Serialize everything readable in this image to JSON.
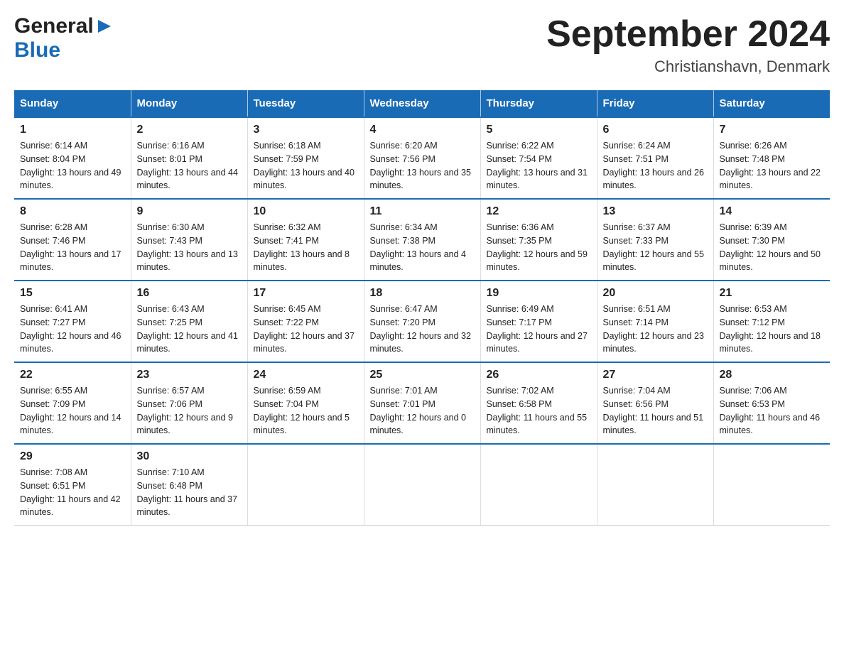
{
  "header": {
    "logo_general": "General",
    "logo_blue": "Blue",
    "month_title": "September 2024",
    "location": "Christianshavn, Denmark"
  },
  "calendar": {
    "days_of_week": [
      "Sunday",
      "Monday",
      "Tuesday",
      "Wednesday",
      "Thursday",
      "Friday",
      "Saturday"
    ],
    "weeks": [
      [
        {
          "day": "1",
          "sunrise": "6:14 AM",
          "sunset": "8:04 PM",
          "daylight": "13 hours and 49 minutes."
        },
        {
          "day": "2",
          "sunrise": "6:16 AM",
          "sunset": "8:01 PM",
          "daylight": "13 hours and 44 minutes."
        },
        {
          "day": "3",
          "sunrise": "6:18 AM",
          "sunset": "7:59 PM",
          "daylight": "13 hours and 40 minutes."
        },
        {
          "day": "4",
          "sunrise": "6:20 AM",
          "sunset": "7:56 PM",
          "daylight": "13 hours and 35 minutes."
        },
        {
          "day": "5",
          "sunrise": "6:22 AM",
          "sunset": "7:54 PM",
          "daylight": "13 hours and 31 minutes."
        },
        {
          "day": "6",
          "sunrise": "6:24 AM",
          "sunset": "7:51 PM",
          "daylight": "13 hours and 26 minutes."
        },
        {
          "day": "7",
          "sunrise": "6:26 AM",
          "sunset": "7:48 PM",
          "daylight": "13 hours and 22 minutes."
        }
      ],
      [
        {
          "day": "8",
          "sunrise": "6:28 AM",
          "sunset": "7:46 PM",
          "daylight": "13 hours and 17 minutes."
        },
        {
          "day": "9",
          "sunrise": "6:30 AM",
          "sunset": "7:43 PM",
          "daylight": "13 hours and 13 minutes."
        },
        {
          "day": "10",
          "sunrise": "6:32 AM",
          "sunset": "7:41 PM",
          "daylight": "13 hours and 8 minutes."
        },
        {
          "day": "11",
          "sunrise": "6:34 AM",
          "sunset": "7:38 PM",
          "daylight": "13 hours and 4 minutes."
        },
        {
          "day": "12",
          "sunrise": "6:36 AM",
          "sunset": "7:35 PM",
          "daylight": "12 hours and 59 minutes."
        },
        {
          "day": "13",
          "sunrise": "6:37 AM",
          "sunset": "7:33 PM",
          "daylight": "12 hours and 55 minutes."
        },
        {
          "day": "14",
          "sunrise": "6:39 AM",
          "sunset": "7:30 PM",
          "daylight": "12 hours and 50 minutes."
        }
      ],
      [
        {
          "day": "15",
          "sunrise": "6:41 AM",
          "sunset": "7:27 PM",
          "daylight": "12 hours and 46 minutes."
        },
        {
          "day": "16",
          "sunrise": "6:43 AM",
          "sunset": "7:25 PM",
          "daylight": "12 hours and 41 minutes."
        },
        {
          "day": "17",
          "sunrise": "6:45 AM",
          "sunset": "7:22 PM",
          "daylight": "12 hours and 37 minutes."
        },
        {
          "day": "18",
          "sunrise": "6:47 AM",
          "sunset": "7:20 PM",
          "daylight": "12 hours and 32 minutes."
        },
        {
          "day": "19",
          "sunrise": "6:49 AM",
          "sunset": "7:17 PM",
          "daylight": "12 hours and 27 minutes."
        },
        {
          "day": "20",
          "sunrise": "6:51 AM",
          "sunset": "7:14 PM",
          "daylight": "12 hours and 23 minutes."
        },
        {
          "day": "21",
          "sunrise": "6:53 AM",
          "sunset": "7:12 PM",
          "daylight": "12 hours and 18 minutes."
        }
      ],
      [
        {
          "day": "22",
          "sunrise": "6:55 AM",
          "sunset": "7:09 PM",
          "daylight": "12 hours and 14 minutes."
        },
        {
          "day": "23",
          "sunrise": "6:57 AM",
          "sunset": "7:06 PM",
          "daylight": "12 hours and 9 minutes."
        },
        {
          "day": "24",
          "sunrise": "6:59 AM",
          "sunset": "7:04 PM",
          "daylight": "12 hours and 5 minutes."
        },
        {
          "day": "25",
          "sunrise": "7:01 AM",
          "sunset": "7:01 PM",
          "daylight": "12 hours and 0 minutes."
        },
        {
          "day": "26",
          "sunrise": "7:02 AM",
          "sunset": "6:58 PM",
          "daylight": "11 hours and 55 minutes."
        },
        {
          "day": "27",
          "sunrise": "7:04 AM",
          "sunset": "6:56 PM",
          "daylight": "11 hours and 51 minutes."
        },
        {
          "day": "28",
          "sunrise": "7:06 AM",
          "sunset": "6:53 PM",
          "daylight": "11 hours and 46 minutes."
        }
      ],
      [
        {
          "day": "29",
          "sunrise": "7:08 AM",
          "sunset": "6:51 PM",
          "daylight": "11 hours and 42 minutes."
        },
        {
          "day": "30",
          "sunrise": "7:10 AM",
          "sunset": "6:48 PM",
          "daylight": "11 hours and 37 minutes."
        },
        null,
        null,
        null,
        null,
        null
      ]
    ]
  }
}
